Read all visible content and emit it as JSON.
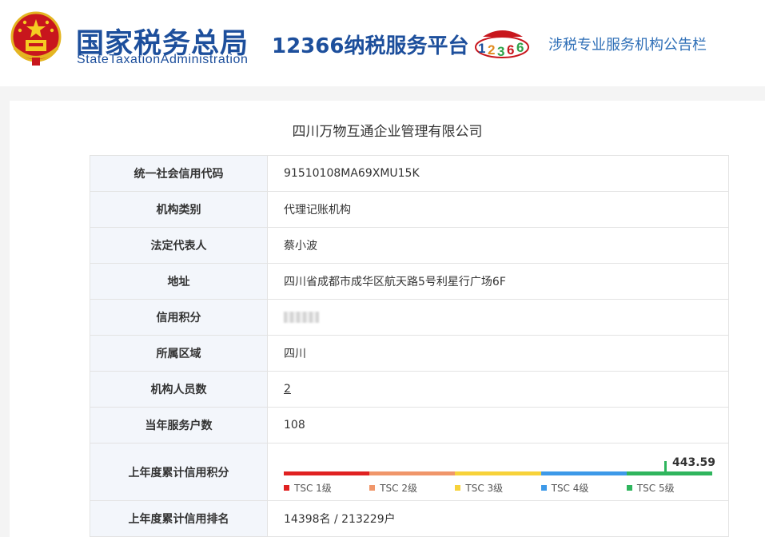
{
  "header": {
    "brand_cn": "国家税务总局",
    "brand_en": "StateTaxationAdministration",
    "platform": "12366纳税服务平台",
    "logo_digits": [
      "1",
      "2",
      "3",
      "6",
      "6"
    ],
    "bulletin": "涉税专业服务机构公告栏",
    "emblem_icon": "national-emblem-icon",
    "colors": {
      "brand": "#1d4f9c",
      "bulletin": "#2f6fb7"
    }
  },
  "company": {
    "name": "四川万物互通企业管理有限公司"
  },
  "rows": [
    {
      "label": "统一社会信用代码",
      "value": "91510108MA69XMU15K"
    },
    {
      "label": "机构类别",
      "value": "代理记账机构"
    },
    {
      "label": "法定代表人",
      "value": "蔡小波"
    },
    {
      "label": "地址",
      "value": "四川省成都市成华区航天路5号利星行广场6F"
    },
    {
      "label": "信用积分",
      "value": ""
    },
    {
      "label": "所属区域",
      "value": "四川"
    },
    {
      "label": "机构人员数",
      "value": "2"
    },
    {
      "label": "当年服务户数",
      "value": "108"
    },
    {
      "label": "上年度累计信用积分",
      "value": "443.59"
    },
    {
      "label": "上年度累计信用排名",
      "value": "14398名 / 213229户"
    }
  ],
  "credit_scale": {
    "score": 443.59,
    "position_fraction": 0.89,
    "levels": [
      {
        "label": "TSC 1级",
        "color": "#e02121"
      },
      {
        "label": "TSC 2级",
        "color": "#f0966a"
      },
      {
        "label": "TSC 3级",
        "color": "#f7d23a"
      },
      {
        "label": "TSC 4级",
        "color": "#3d99e8"
      },
      {
        "label": "TSC 5级",
        "color": "#2fb55d"
      }
    ]
  }
}
